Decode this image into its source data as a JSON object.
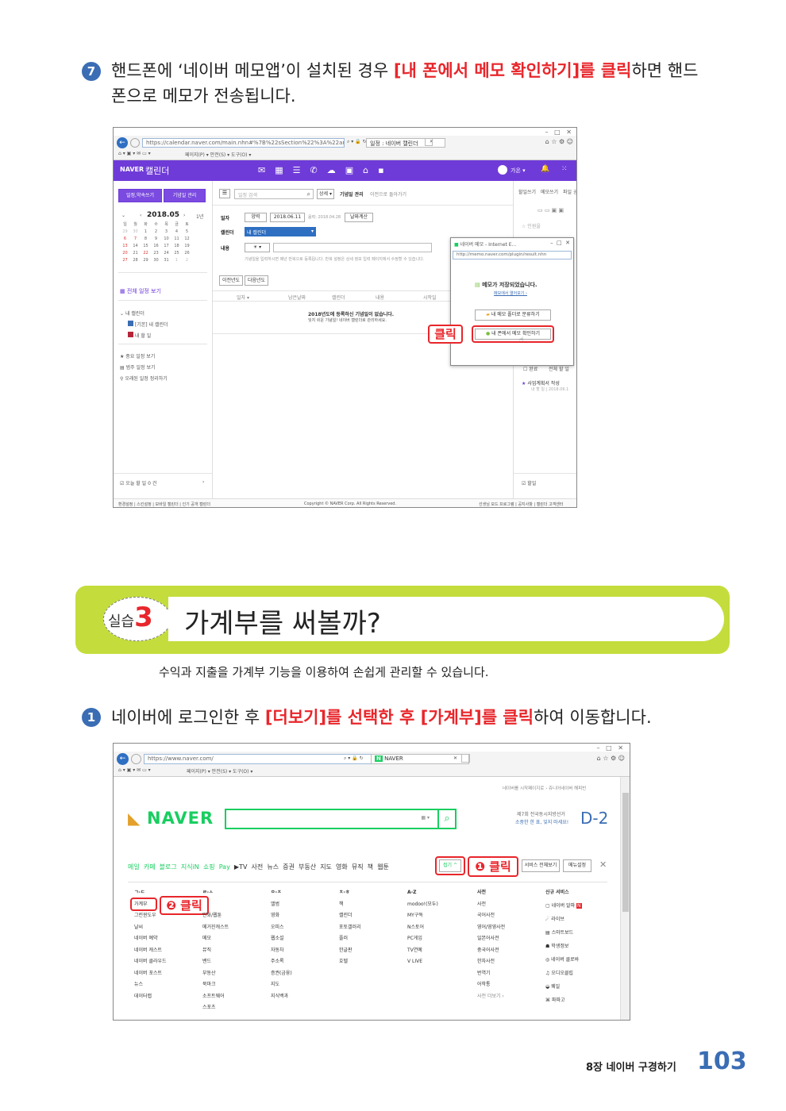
{
  "step7": {
    "num": "7",
    "line1_pre": "핸드폰에 ‘네이버 메모앱’이 설치된 경우 ",
    "line1_hl": "[내 폰에서 메모 확인하기]를 클릭",
    "line1_post": "하면 핸드",
    "line2": "폰으로 메모가 전송됩니다."
  },
  "shot1": {
    "url": "https://calendar.naver.com/main.nhn#%7B%22sSection%22%3A%22annive",
    "tab": "일정 : 네이버 캘린더",
    "menubar": "페이지(P) ▾   안전(S) ▾   도구(O) ▾",
    "brand": "NAVER",
    "app_title": "캘린더",
    "user": "가온 ▾",
    "btn_schedule": "일정,약속쓰기",
    "btn_anniv": "기념일 관리",
    "month": "2018.05",
    "tab_1y": "1년",
    "weekdays": [
      "일",
      "월",
      "화",
      "수",
      "목",
      "금",
      "토"
    ],
    "weeks": [
      [
        "29",
        "30",
        "1",
        "2",
        "3",
        "4",
        "5"
      ],
      [
        "6",
        "7",
        "8",
        "9",
        "10",
        "11",
        "12"
      ],
      [
        "13",
        "14",
        "15",
        "16",
        "17",
        "18",
        "19"
      ],
      [
        "20",
        "21",
        "22",
        "23",
        "24",
        "25",
        "26"
      ],
      [
        "27",
        "28",
        "29",
        "30",
        "31",
        "1",
        "2"
      ]
    ],
    "all_view": "전체 일정 보기",
    "my_cal": "내 캘린더",
    "cal_items": [
      "[기본] 내 캘린더",
      "내 할 일"
    ],
    "side_links": [
      "중요 일정 보기",
      "범주 일정 보기",
      "오래된 일정 정리하기"
    ],
    "today_todo": "오늘 할 일 0 건",
    "search_ph": "일정 검색",
    "search_scope": "상세 ▾",
    "anniv_mgmt": "기념일 관리",
    "back_link": "이전으로 돌아가기",
    "label_date": "일자",
    "date_mode": "양력",
    "date_value": "2018.06.11",
    "date_note": "음력: 2018.04.28",
    "days_calc": "날짜계산",
    "label_cal": "캘린더",
    "cal_select": "내 캘린더",
    "label_content": "내용",
    "content_hint": "기념일을 입력하시면 매년 반복으로 등록됩니다. 반복 설정은 상세 정보 입력 페이지에서 수정할 수 있습니다.",
    "prev_year": "이전년도",
    "next_year": "다음년도",
    "cols": [
      "일자 ▾",
      "남은날짜",
      "캘린더",
      "내용",
      "시작일"
    ],
    "empty1": "2018년도에 등록하신 기념일이 없습니다.",
    "empty2": "잊지 쉬운 기념일! 네이버 캘린더로 관리하세요.",
    "right_tabs": [
      "할일쓰기",
      "메모쓰기",
      "파일 공유"
    ],
    "popup_title": "네이버 메모 - Internet E...",
    "popup_url": "http://memo.naver.com/plugin/result.nhn",
    "popup_msg": "메모가 저장되었습니다.",
    "popup_link": "메모에서 열어보기 ›",
    "popup_btn1": "내 메모 폴더로 분류하기",
    "popup_btn2": "내 폰에서 메모 확인하기",
    "click": "클릭",
    "right_item": "사업계획서 작성",
    "right_sub": "내 할 일 | 2018.06.1",
    "right_done": "완료",
    "right_all": "전체 할 일",
    "right_bottom": "할일",
    "right_import": "인원을",
    "footer_left": "환경설정 | 스킨설정 | 모바일 캘린더 | 인기 공개 캘린더",
    "footer_mid": "Copyright © NAVER Corp. All Rights Reserved.",
    "footer_right": "선생님 모드 프로그램 | 공지사항 | 캘린더 고객센터"
  },
  "section": {
    "label_pre": "실습",
    "label_num": "3",
    "title": "가계부를 써볼까?",
    "desc": "수익과 지출을 가계부 기능을 이용하여 손쉽게 관리할 수 있습니다."
  },
  "step1": {
    "num": "1",
    "pre": "네이버에 로그인한 후 ",
    "hl1": "[더보기]를 선택한 후 [가계부]를 클릭",
    "post": "하여 이동합니다."
  },
  "shot2": {
    "url": "https://www.naver.com/",
    "tab": "NAVER",
    "menubar": "페이지(P) ▾   안전(S) ▾   도구(O) ▾",
    "top_links": "네이버를 시작페이지로 ›   쥬니어네이버   해피빈",
    "logo": "NAVER",
    "promo1": "제7회 전국동시지방선거",
    "promo2": "소중한 한 표, 잊지 마세요!",
    "promo_dday": "D-2",
    "nav": [
      "메일",
      "카페",
      "블로그",
      "지식iN",
      "쇼핑",
      "Pay",
      "▶TV",
      "사전",
      "뉴스",
      "증권",
      "부동산",
      "지도",
      "영화",
      "뮤직",
      "책",
      "웹툰"
    ],
    "fold": "접기 ^",
    "click1": "❶ 클릭",
    "click2": "❷ 클릭",
    "all_service": "서비스 전체보기",
    "menu_settings": "메뉴설정",
    "col_heads": [
      "ㄱ-ㄷ",
      "ㄹ-ㅅ",
      "ㅇ-ㅈ",
      "ㅊ-ㅎ",
      "A-Z",
      "사전",
      "신규 서비스"
    ],
    "col1": [
      "가계부",
      "그린윈도우",
      "날씨",
      "네이버 예약",
      "네이버 캐스트",
      "네이버 클라우드",
      "네이버 포스트",
      "뉴스",
      "데이터랩"
    ],
    "col2": [
      "메",
      "만화/웹툰",
      "메거진캐스트",
      "메모",
      "뮤직",
      "밴드",
      "부동산",
      "북마크",
      "소프트웨어",
      "스포츠"
    ],
    "col3": [
      "앨범",
      "영화",
      "오피스",
      "웹소설",
      "자동차",
      "주소록",
      "증권(금융)",
      "지도",
      "지식백과"
    ],
    "col4": [
      "책",
      "캘린더",
      "포토갤러리",
      "플러",
      "한글판",
      "호텔"
    ],
    "col5": [
      "modoo!(모두)",
      "MY구독",
      "N스토어",
      "PC게임",
      "TV연예",
      "V LIVE"
    ],
    "col6": [
      "사전",
      "국어사전",
      "영어/영영사전",
      "일본어사전",
      "중국어사전",
      "한자사전",
      "번역기",
      "어학통",
      "사전 더보기 ›"
    ],
    "col7": [
      "네이버 알파",
      "라이브",
      "스마트보드",
      "학생정보",
      "네이버 클로바",
      "오디오클립",
      "웨일",
      "파파고"
    ]
  },
  "footer": {
    "chapter": "8장 네이버 구경하기",
    "page": "103"
  },
  "colors": {
    "accent_red": "#e8262b",
    "step_blue": "#3a6db4",
    "naver_purple": "#6f3bd8",
    "naver_green": "#19ce60",
    "banner_green": "#c4dd3c"
  }
}
